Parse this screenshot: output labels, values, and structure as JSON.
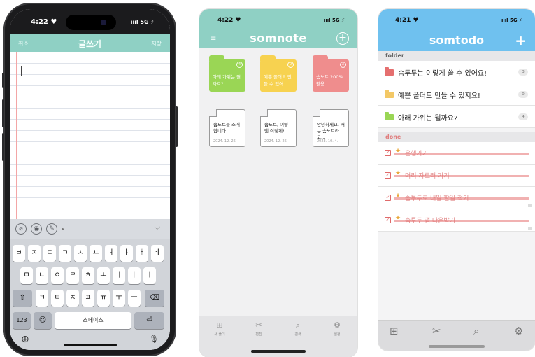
{
  "phone1": {
    "status": {
      "time": "4:22 ♥",
      "network": "ıııl 5G ⚡"
    },
    "nav": {
      "cancel": "취소",
      "title": "글쓰기",
      "save": "저장"
    },
    "keyboard": {
      "row1": [
        "ㅂ",
        "ㅈ",
        "ㄷ",
        "ㄱ",
        "ㅅ",
        "ㅛ",
        "ㅕ",
        "ㅑ",
        "ㅐ",
        "ㅔ"
      ],
      "row2": [
        "ㅁ",
        "ㄴ",
        "ㅇ",
        "ㄹ",
        "ㅎ",
        "ㅗ",
        "ㅓ",
        "ㅏ",
        "ㅣ"
      ],
      "row3": [
        "ㅋ",
        "ㅌ",
        "ㅊ",
        "ㅍ",
        "ㅠ",
        "ㅜ",
        "ㅡ"
      ],
      "shift": "⇧",
      "backspace": "⌫",
      "numbers": "123",
      "emoji": "☺",
      "space": "스페이스",
      "return": "⏎",
      "globe": "⊕",
      "mic": "🎙"
    },
    "icons": {
      "paperclip": "⌀",
      "image": "◉",
      "draw": "✎",
      "chevron": "⌵"
    }
  },
  "phone2": {
    "status": {
      "time": "4:22 ♥",
      "network": "ıııl 5G ⚡"
    },
    "header": {
      "menu": "≡",
      "logo": "somnote",
      "add": "+"
    },
    "folders": [
      {
        "label": "아래 가위는 뭘까요?",
        "count": "4",
        "color": "#9ad655"
      },
      {
        "label": "예쁜 폴더도 만들 수 있어",
        "count": "0",
        "color": "#f7d250"
      },
      {
        "label": "솜노트 200% 활용",
        "count": "3",
        "color": "#ef8d8d"
      }
    ],
    "notes": [
      {
        "text": "솜노트를 소개합니다.",
        "date": "2024. 12. 26."
      },
      {
        "text": "솜노트, 이렇 맨 이렇게!",
        "date": "2024. 12. 26."
      },
      {
        "text": "안녕하세요. 저는 솜노트라고…",
        "date": "2023. 10. 4."
      }
    ],
    "tabs": [
      {
        "icon": "⊞",
        "label": "새 폴더"
      },
      {
        "icon": "✂",
        "label": "편집"
      },
      {
        "icon": "⌕",
        "label": "검색"
      },
      {
        "icon": "⚙",
        "label": "설정"
      }
    ]
  },
  "phone3": {
    "status": {
      "time": "4:21 ♥",
      "network": "ıııl 5G ⚡"
    },
    "header": {
      "logo": "somtodo",
      "add": "+"
    },
    "folder_section": "folder",
    "folders": [
      {
        "label": "솜투두는 이렇게 쓸 수 있어요!",
        "count": "3",
        "color": "#e56f6f"
      },
      {
        "label": "예쁜 폴더도 만들 수 있지요!",
        "count": "0",
        "color": "#f3c866"
      },
      {
        "label": "아래 가위는 뭘까요?",
        "count": "4",
        "color": "#9ad655"
      }
    ],
    "done_section": "done",
    "done_items": [
      {
        "label": "은행가기"
      },
      {
        "label": "머리 자르러 가기"
      },
      {
        "label": "솜투두로 내일 할일 적기"
      },
      {
        "label": "솜투두 앱 다운받기"
      }
    ],
    "tabs": {
      "new_folder": "⊞",
      "edit": "✂",
      "search": "⌕",
      "settings": "⚙"
    }
  }
}
